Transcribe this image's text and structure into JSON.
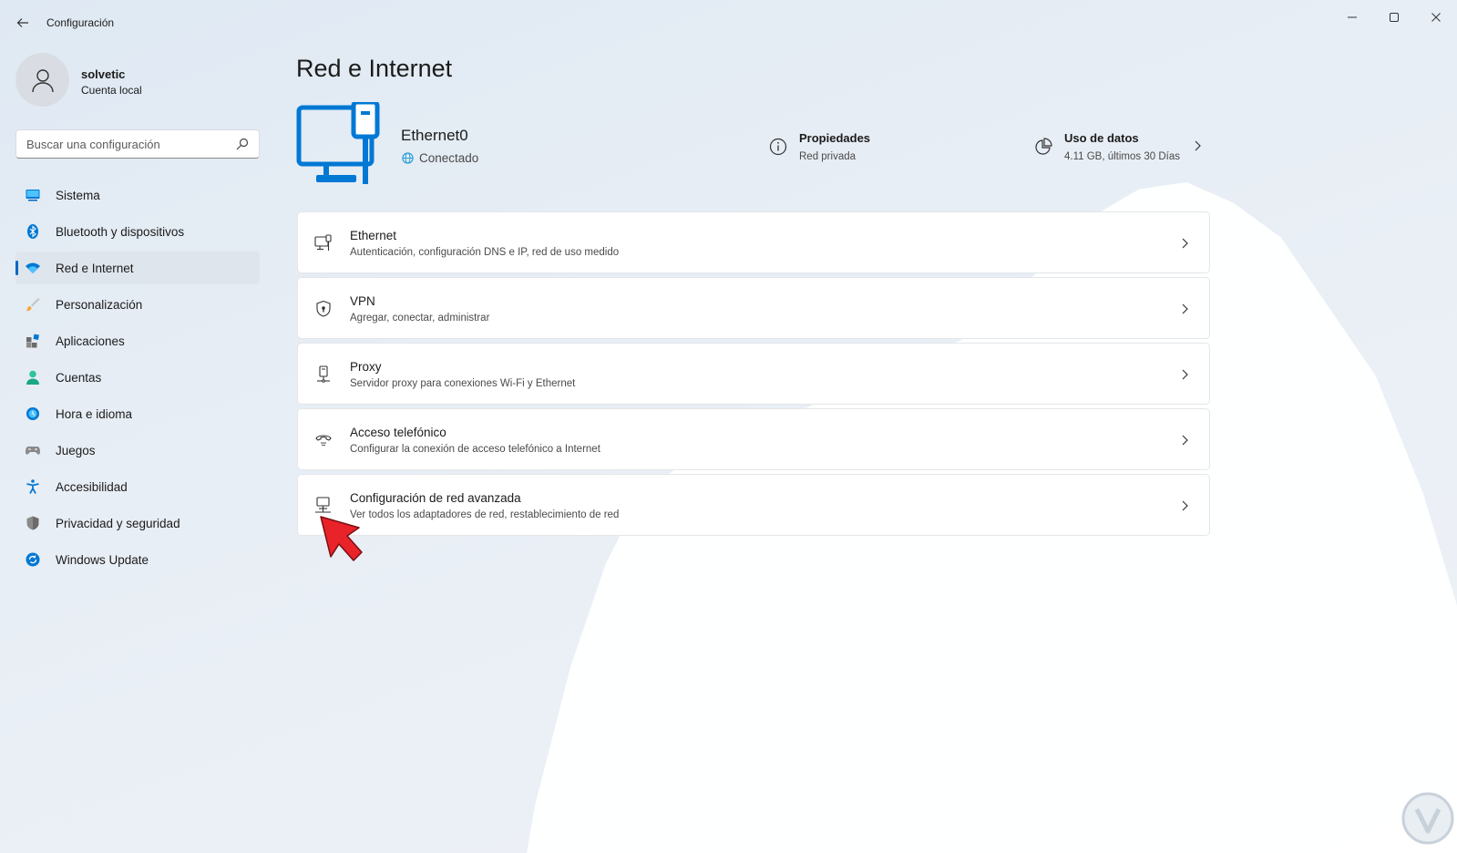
{
  "window": {
    "title": "Configuración"
  },
  "profile": {
    "name": "solvetic",
    "account_type": "Cuenta local"
  },
  "search": {
    "placeholder": "Buscar una configuración"
  },
  "sidebar": {
    "items": [
      {
        "label": "Sistema",
        "icon": "system-icon"
      },
      {
        "label": "Bluetooth y dispositivos",
        "icon": "bluetooth-icon"
      },
      {
        "label": "Red e Internet",
        "icon": "wifi-icon",
        "active": true
      },
      {
        "label": "Personalización",
        "icon": "brush-icon"
      },
      {
        "label": "Aplicaciones",
        "icon": "apps-icon"
      },
      {
        "label": "Cuentas",
        "icon": "account-icon"
      },
      {
        "label": "Hora e idioma",
        "icon": "globe-clock-icon"
      },
      {
        "label": "Juegos",
        "icon": "gamepad-icon"
      },
      {
        "label": "Accesibilidad",
        "icon": "accessibility-icon"
      },
      {
        "label": "Privacidad y seguridad",
        "icon": "shield-icon"
      },
      {
        "label": "Windows Update",
        "icon": "update-icon"
      }
    ]
  },
  "main": {
    "title": "Red e Internet",
    "device": {
      "name": "Ethernet0",
      "status": "Conectado"
    },
    "properties": {
      "title": "Propiedades",
      "subtitle": "Red privada"
    },
    "data_usage": {
      "title": "Uso de datos",
      "subtitle": "4.11 GB, últimos 30 Días"
    },
    "cards": [
      {
        "title": "Ethernet",
        "subtitle": "Autenticación, configuración DNS e IP, red de uso medido",
        "icon": "ethernet-icon"
      },
      {
        "title": "VPN",
        "subtitle": "Agregar, conectar, administrar",
        "icon": "vpn-shield-icon"
      },
      {
        "title": "Proxy",
        "subtitle": "Servidor proxy para conexiones Wi-Fi y Ethernet",
        "icon": "proxy-icon"
      },
      {
        "title": "Acceso telefónico",
        "subtitle": "Configurar la conexión de acceso telefónico a Internet",
        "icon": "dialup-icon"
      },
      {
        "title": "Configuración de red avanzada",
        "subtitle": "Ver todos los adaptadores de red, restablecimiento de red",
        "icon": "network-adapter-icon"
      }
    ]
  },
  "colors": {
    "accent": "#0067c0",
    "device_blue": "#0078d4",
    "pointer_red": "#e8232a"
  }
}
